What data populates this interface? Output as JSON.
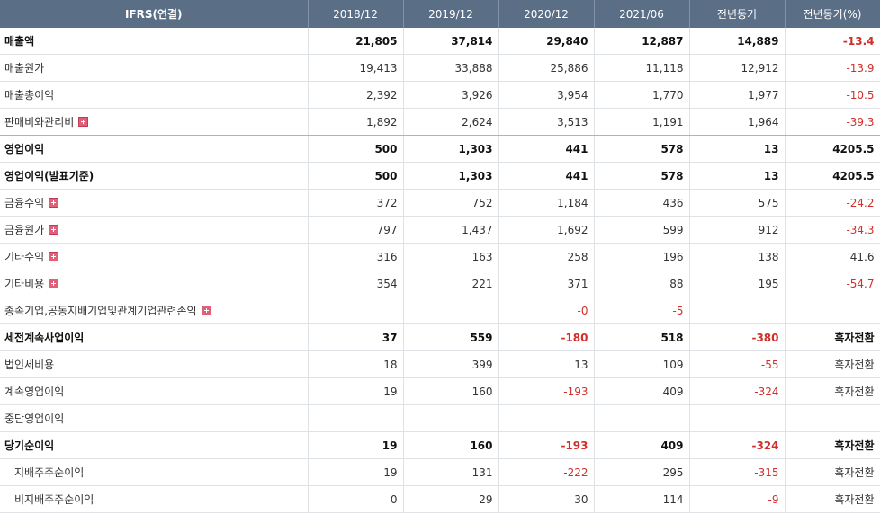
{
  "header": [
    "IFRS(연결)",
    "2018/12",
    "2019/12",
    "2020/12",
    "2021/06",
    "전년동기",
    "전년동기(%)"
  ],
  "rows": [
    {
      "label": "매출액",
      "bold": true,
      "expand": false,
      "sep": false,
      "indent": false,
      "values": [
        "21,805",
        "37,814",
        "29,840",
        "12,887",
        "14,889",
        "-13.4"
      ],
      "neg": [
        false,
        false,
        false,
        false,
        false,
        true
      ]
    },
    {
      "label": "매출원가",
      "bold": false,
      "expand": false,
      "sep": false,
      "indent": false,
      "values": [
        "19,413",
        "33,888",
        "25,886",
        "11,118",
        "12,912",
        "-13.9"
      ],
      "neg": [
        false,
        false,
        false,
        false,
        false,
        true
      ]
    },
    {
      "label": "매출총이익",
      "bold": false,
      "expand": false,
      "sep": false,
      "indent": false,
      "values": [
        "2,392",
        "3,926",
        "3,954",
        "1,770",
        "1,977",
        "-10.5"
      ],
      "neg": [
        false,
        false,
        false,
        false,
        false,
        true
      ]
    },
    {
      "label": "판매비와관리비",
      "bold": false,
      "expand": true,
      "sep": true,
      "indent": false,
      "values": [
        "1,892",
        "2,624",
        "3,513",
        "1,191",
        "1,964",
        "-39.3"
      ],
      "neg": [
        false,
        false,
        false,
        false,
        false,
        true
      ]
    },
    {
      "label": "영업이익",
      "bold": true,
      "expand": false,
      "sep": false,
      "indent": false,
      "values": [
        "500",
        "1,303",
        "441",
        "578",
        "13",
        "4205.5"
      ],
      "neg": [
        false,
        false,
        false,
        false,
        false,
        false
      ]
    },
    {
      "label": "영업이익(발표기준)",
      "bold": true,
      "expand": false,
      "sep": false,
      "indent": false,
      "values": [
        "500",
        "1,303",
        "441",
        "578",
        "13",
        "4205.5"
      ],
      "neg": [
        false,
        false,
        false,
        false,
        false,
        false
      ]
    },
    {
      "label": "금융수익",
      "bold": false,
      "expand": true,
      "sep": false,
      "indent": false,
      "values": [
        "372",
        "752",
        "1,184",
        "436",
        "575",
        "-24.2"
      ],
      "neg": [
        false,
        false,
        false,
        false,
        false,
        true
      ]
    },
    {
      "label": "금융원가",
      "bold": false,
      "expand": true,
      "sep": false,
      "indent": false,
      "values": [
        "797",
        "1,437",
        "1,692",
        "599",
        "912",
        "-34.3"
      ],
      "neg": [
        false,
        false,
        false,
        false,
        false,
        true
      ]
    },
    {
      "label": "기타수익",
      "bold": false,
      "expand": true,
      "sep": false,
      "indent": false,
      "values": [
        "316",
        "163",
        "258",
        "196",
        "138",
        "41.6"
      ],
      "neg": [
        false,
        false,
        false,
        false,
        false,
        false
      ]
    },
    {
      "label": "기타비용",
      "bold": false,
      "expand": true,
      "sep": false,
      "indent": false,
      "values": [
        "354",
        "221",
        "371",
        "88",
        "195",
        "-54.7"
      ],
      "neg": [
        false,
        false,
        false,
        false,
        false,
        true
      ]
    },
    {
      "label": "종속기업,공동지배기업및관계기업관련손익",
      "bold": false,
      "expand": true,
      "sep": false,
      "indent": false,
      "values": [
        "",
        "",
        "-0",
        "-5",
        "",
        ""
      ],
      "neg": [
        false,
        false,
        true,
        true,
        false,
        false
      ]
    },
    {
      "label": "세전계속사업이익",
      "bold": true,
      "expand": false,
      "sep": false,
      "indent": false,
      "values": [
        "37",
        "559",
        "-180",
        "518",
        "-380",
        "흑자전환"
      ],
      "neg": [
        false,
        false,
        true,
        false,
        true,
        false
      ]
    },
    {
      "label": "법인세비용",
      "bold": false,
      "expand": false,
      "sep": false,
      "indent": false,
      "values": [
        "18",
        "399",
        "13",
        "109",
        "-55",
        "흑자전환"
      ],
      "neg": [
        false,
        false,
        false,
        false,
        true,
        false
      ]
    },
    {
      "label": "계속영업이익",
      "bold": false,
      "expand": false,
      "sep": false,
      "indent": false,
      "values": [
        "19",
        "160",
        "-193",
        "409",
        "-324",
        "흑자전환"
      ],
      "neg": [
        false,
        false,
        true,
        false,
        true,
        false
      ]
    },
    {
      "label": "중단영업이익",
      "bold": false,
      "expand": false,
      "sep": false,
      "indent": false,
      "values": [
        "",
        "",
        "",
        "",
        "",
        ""
      ],
      "neg": [
        false,
        false,
        false,
        false,
        false,
        false
      ]
    },
    {
      "label": "당기순이익",
      "bold": true,
      "expand": false,
      "sep": false,
      "indent": false,
      "values": [
        "19",
        "160",
        "-193",
        "409",
        "-324",
        "흑자전환"
      ],
      "neg": [
        false,
        false,
        true,
        false,
        true,
        false
      ]
    },
    {
      "label": "지배주주순이익",
      "bold": false,
      "expand": false,
      "sep": false,
      "indent": true,
      "values": [
        "19",
        "131",
        "-222",
        "295",
        "-315",
        "흑자전환"
      ],
      "neg": [
        false,
        false,
        true,
        false,
        true,
        false
      ]
    },
    {
      "label": "비지배주주순이익",
      "bold": false,
      "expand": false,
      "sep": false,
      "indent": true,
      "values": [
        "0",
        "29",
        "30",
        "114",
        "-9",
        "흑자전환"
      ],
      "neg": [
        false,
        false,
        false,
        false,
        true,
        false
      ]
    }
  ],
  "colors": {
    "header_bg": "#5a6e86",
    "negative": "#d0302b",
    "expand_icon": "#e0607a"
  }
}
